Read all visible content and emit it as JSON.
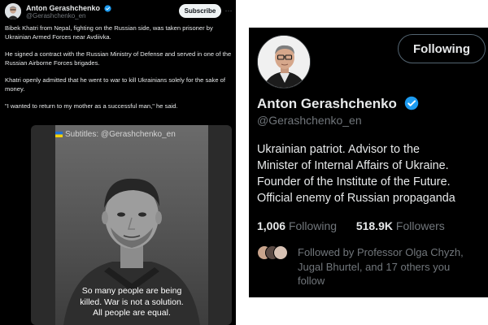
{
  "tweet": {
    "author_name": "Anton Gerashchenko",
    "author_handle": "@Gerashchenko_en",
    "subscribe_label": "Subscribe",
    "more_icon": "ellipsis-icon",
    "paragraphs": [
      "Bibek Khatri from Nepal, fighting on the Russian side, was taken prisoner by Ukrainian Armed Forces near Avdiivka.",
      "He signed a contract with the Russian Ministry of Defense and served in one of the Russian Airborne Forces brigades.",
      "Khatri openly admitted that he went to war to kill Ukrainians solely for the sake of money.",
      "\"I wanted to return to my mother as a successful man,\" he said."
    ],
    "video": {
      "watermark": "Subtitles: @Gerashchenko_en",
      "caption_lines": [
        "So many people are being",
        "killed. War is not a solution.",
        "All people are equal."
      ]
    }
  },
  "profile": {
    "following_label": "Following",
    "name": "Anton Gerashchenko",
    "handle": "@Gerashchenko_en",
    "bio_lines": [
      "Ukrainian patriot. Advisor to the",
      "Minister of Internal Affairs of Ukraine.",
      "Founder of the Institute of the Future.",
      "Official enemy of Russian propaganda"
    ],
    "following_count": "1,006",
    "following_text": "Following",
    "followers_count": "518.9K",
    "followers_text": "Followers",
    "followed_by_lines": [
      "Followed by Professor Olga Chyzh,",
      "Jugal Bhurtel, and 17 others you",
      "follow"
    ]
  },
  "colors": {
    "background": "#000000",
    "text_primary": "#e7e9ea",
    "text_secondary": "#71767b",
    "verified_blue": "#1d9bf0"
  }
}
